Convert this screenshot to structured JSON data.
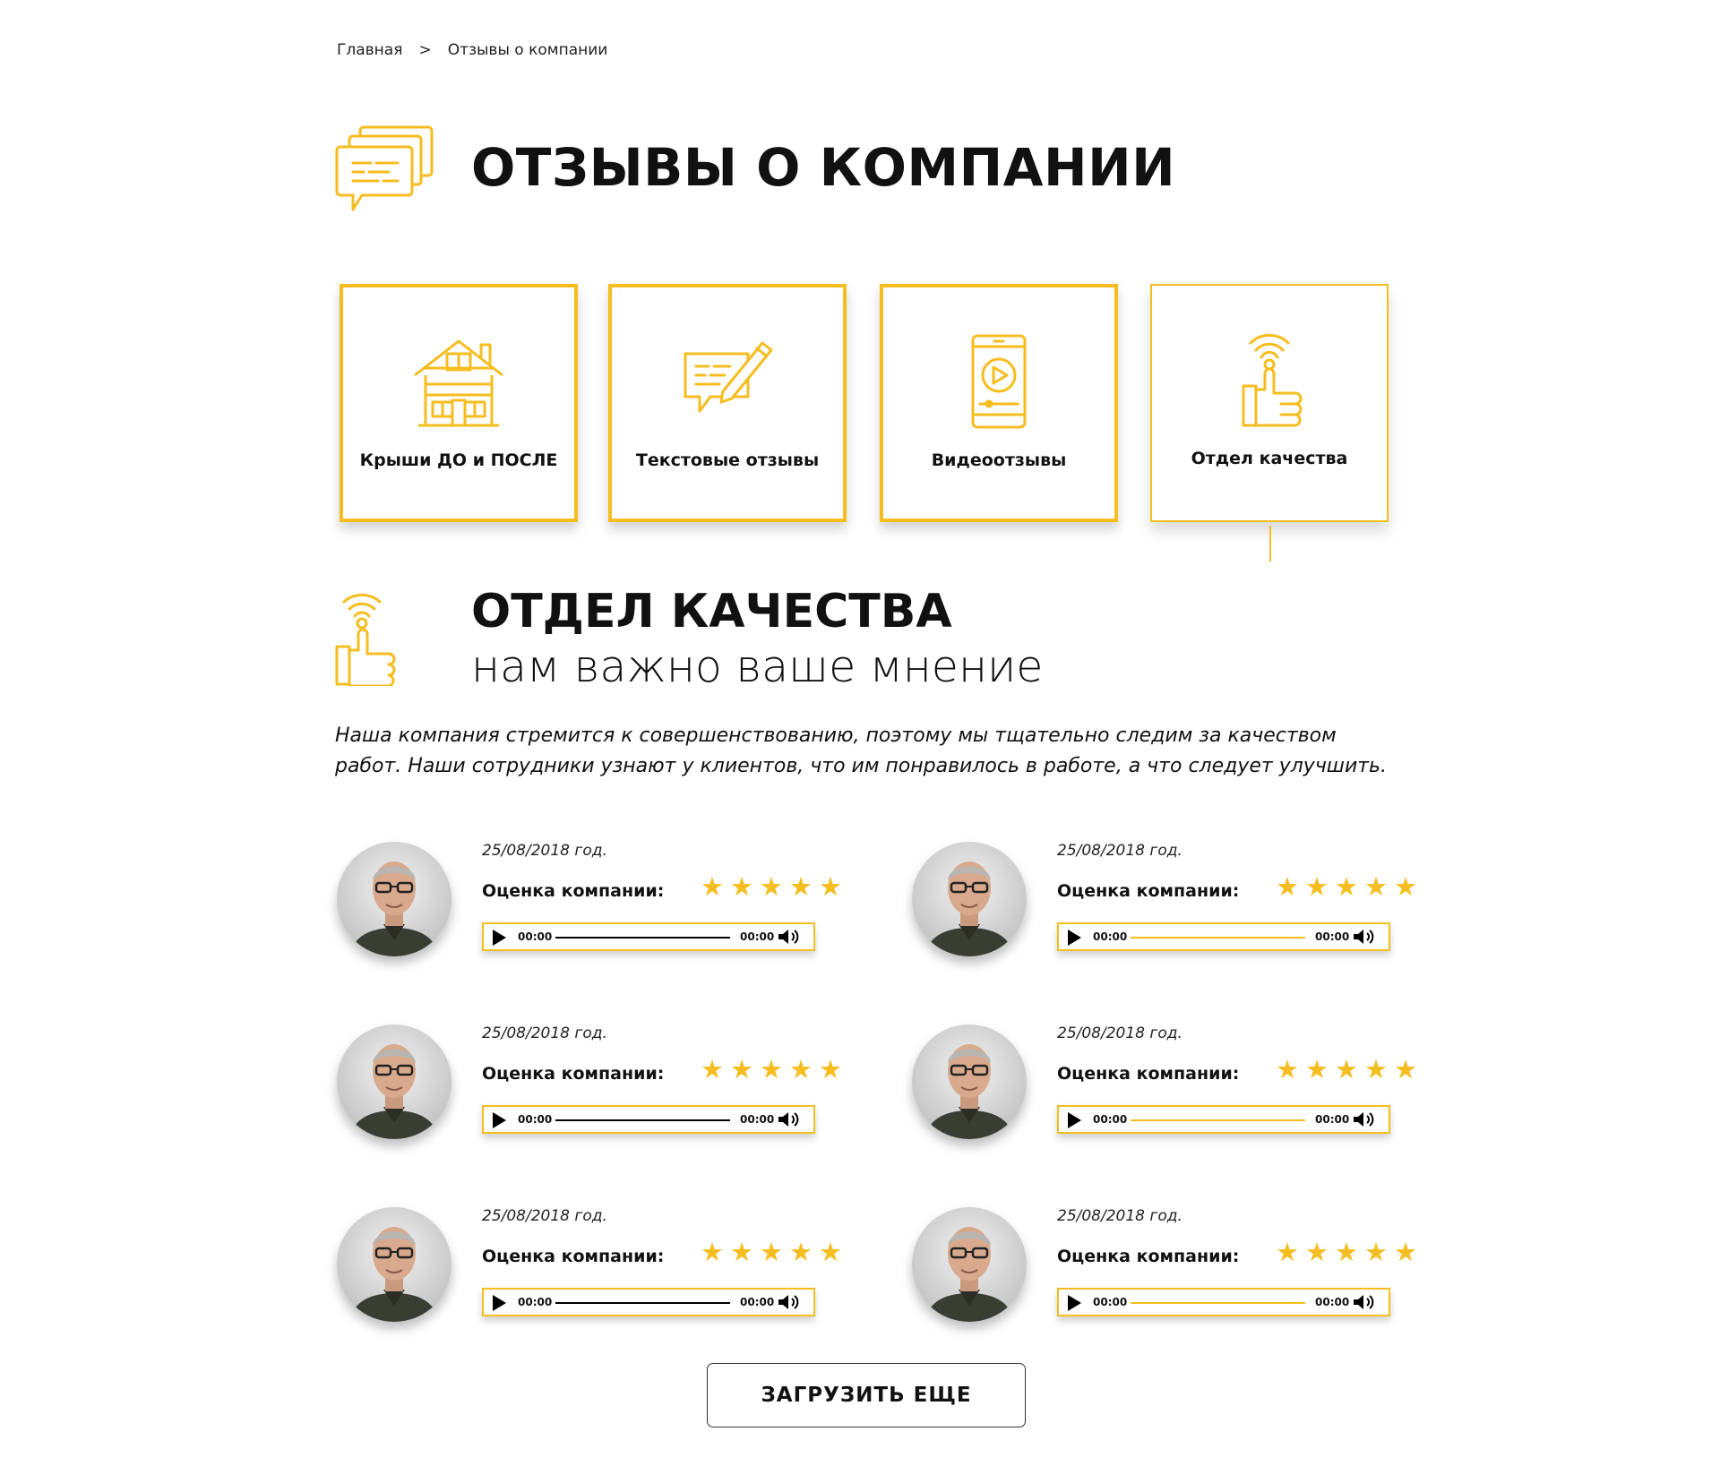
{
  "breadcrumb": {
    "home": "Главная",
    "separator": ">",
    "current": "Отзывы о компании"
  },
  "page": {
    "title": "ОТЗЫВЫ О КОМПАНИИ",
    "icon": "chat-bubbles-icon"
  },
  "categories": [
    {
      "label": "Крыши ДО и ПОСЛЕ",
      "icon": "house-icon",
      "active": false
    },
    {
      "label": "Текстовые отзывы",
      "icon": "chat-pencil-icon",
      "active": false
    },
    {
      "label": "Видеоотзывы",
      "icon": "phone-video-icon",
      "active": false
    },
    {
      "label": "Отдел качества",
      "icon": "thumbs-up-signal-icon",
      "active": true
    }
  ],
  "section": {
    "title": "ОТДЕЛ КАЧЕСТВА",
    "subtitle": "нам важно ваше мнение",
    "description": "Наша компания стремится к совершенствованию, поэтому мы тщательно следим за качеством работ. Наши сотрудники узнают у клиентов, что им понравилось в работе, а что следует улучшить."
  },
  "reviews": [
    {
      "date": "25/08/2018 год.",
      "rating_label": "Оценка компании:",
      "rating": 5,
      "current_time": "00:00",
      "duration": "00:00"
    },
    {
      "date": "25/08/2018 год.",
      "rating_label": "Оценка компании:",
      "rating": 5,
      "current_time": "00:00",
      "duration": "00:00"
    },
    {
      "date": "25/08/2018 год.",
      "rating_label": "Оценка компании:",
      "rating": 5,
      "current_time": "00:00",
      "duration": "00:00"
    },
    {
      "date": "25/08/2018 год.",
      "rating_label": "Оценка компании:",
      "rating": 5,
      "current_time": "00:00",
      "duration": "00:00"
    },
    {
      "date": "25/08/2018 год.",
      "rating_label": "Оценка компании:",
      "rating": 5,
      "current_time": "00:00",
      "duration": "00:00"
    },
    {
      "date": "25/08/2018 год.",
      "rating_label": "Оценка компании:",
      "rating": 5,
      "current_time": "00:00",
      "duration": "00:00"
    }
  ],
  "load_more_label": "ЗАГРУЗИТЬ ЕЩЕ",
  "colors": {
    "accent": "#f5bd1f",
    "text": "#111111",
    "background": "#ffffff"
  }
}
